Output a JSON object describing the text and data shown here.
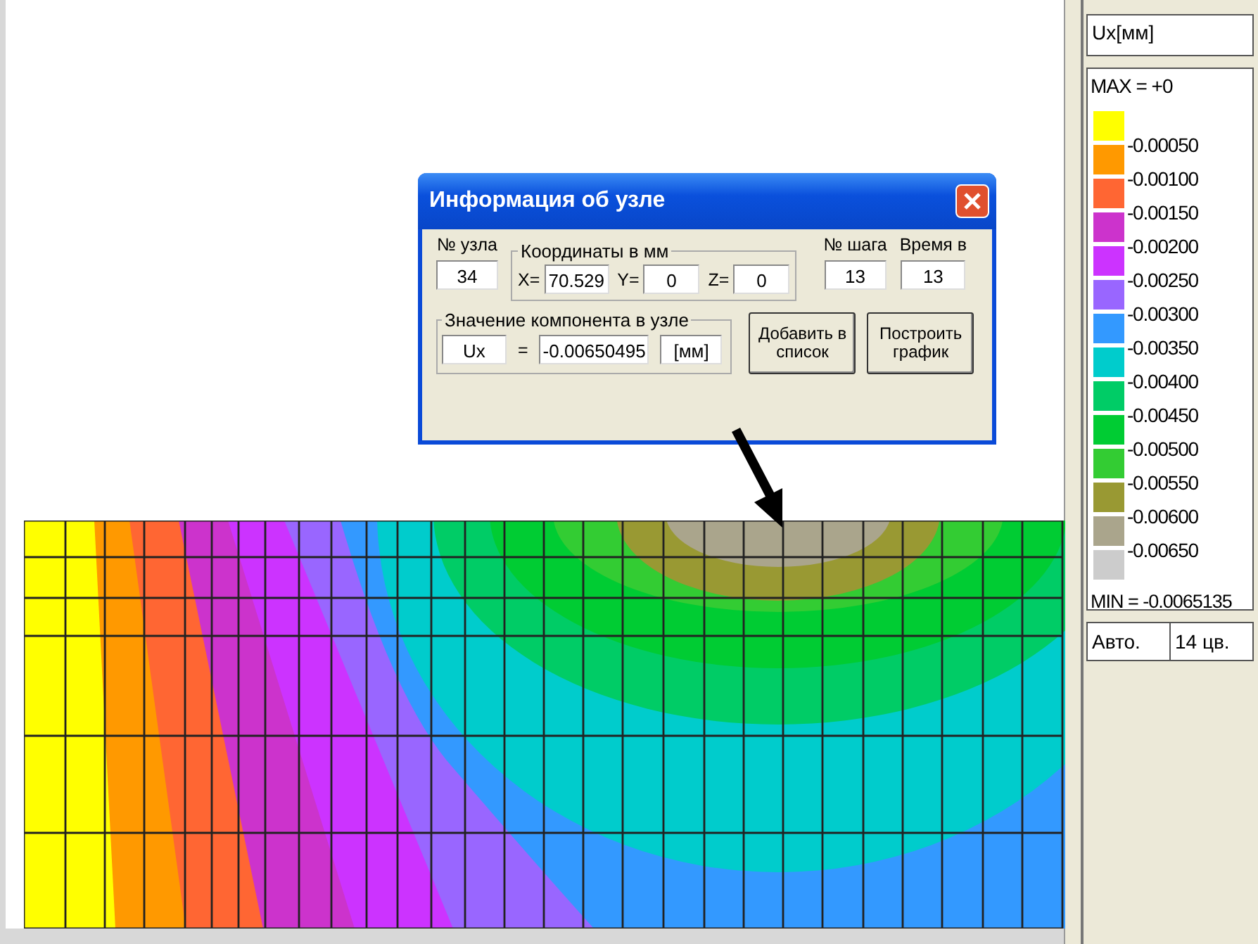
{
  "dialog": {
    "title": "Информация об узле",
    "node": {
      "label": "№ узла",
      "value": "34"
    },
    "coordinates": {
      "legend": "Координаты в мм",
      "fields": [
        {
          "label": "X=",
          "value": "70.529"
        },
        {
          "label": "Y=",
          "value": "0"
        },
        {
          "label": "Z=",
          "value": "0"
        }
      ]
    },
    "step": {
      "label": "№ шага",
      "value": "13"
    },
    "time": {
      "label": "Время в",
      "value": "13"
    },
    "component": {
      "legend": "Значение компонента в узле",
      "name": "Ux",
      "equals": "=",
      "value": "-0.00650495",
      "unit": "[мм]"
    },
    "buttons": [
      "Добавить в список",
      "Построить график"
    ]
  },
  "legend_panel": {
    "quantity": "Ux[мм]",
    "max": "MAX = +0",
    "swatches": [
      {
        "color": "#ffff00"
      },
      {
        "color": "#ff9900"
      },
      {
        "color": "#ff6633"
      },
      {
        "color": "#cc33cc"
      },
      {
        "color": "#cc33ff"
      },
      {
        "color": "#9966ff"
      },
      {
        "color": "#3399ff"
      },
      {
        "color": "#00cccc"
      },
      {
        "color": "#00cc66"
      },
      {
        "color": "#00cc33"
      },
      {
        "color": "#33cc33"
      },
      {
        "color": "#999933"
      },
      {
        "color": "#aaa58c"
      },
      {
        "color": "#cccccc"
      }
    ],
    "labels": [
      "-0.00050",
      "-0.00100",
      "-0.00150",
      "-0.00200",
      "-0.00250",
      "-0.00300",
      "-0.00350",
      "-0.00400",
      "-0.00450",
      "-0.00500",
      "-0.00550",
      "-0.00600",
      "-0.00650"
    ],
    "min": "MIN = -0.0065135",
    "mode": "Авто.",
    "colors": "14 цв."
  }
}
